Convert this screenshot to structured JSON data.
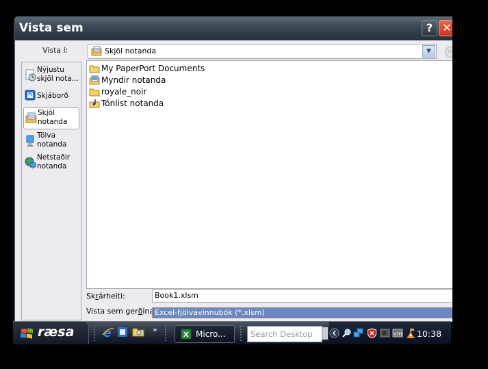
{
  "dialog": {
    "title": "Vista sem",
    "help_button": "?",
    "close_button": "✕",
    "look_in_label": "Vista í:",
    "look_in_value": "Skjöl notanda",
    "places": [
      {
        "label": "Nýjustu\nskjöl nota...",
        "icon": "recent-documents-icon",
        "selected": false
      },
      {
        "label": "Skjáborð",
        "icon": "desktop-icon",
        "selected": false
      },
      {
        "label": "Skjöl\nnotanda",
        "icon": "my-documents-icon",
        "selected": true
      },
      {
        "label": "Tölva\nnotanda",
        "icon": "my-computer-icon",
        "selected": false
      },
      {
        "label": "Netstaðir\nnotanda",
        "icon": "network-places-icon",
        "selected": false
      }
    ],
    "files": [
      {
        "name": "My PaperPort Documents",
        "icon": "folder-icon"
      },
      {
        "name": "Myndir notanda",
        "icon": "pictures-folder-icon"
      },
      {
        "name": "royale_noir",
        "icon": "folder-icon"
      },
      {
        "name": "Tónlist notanda",
        "icon": "music-folder-icon"
      }
    ],
    "file_name_label_pre": "Sk",
    "file_name_label_u": "r",
    "file_name_label_post": "árheiti:",
    "file_name_value": "Book1.xlsm",
    "file_type_label_pre": "Vista sem ger",
    "file_type_label_u": "ð",
    "file_type_label_post": "ina:",
    "file_type_value": "Excel-fjölvavinnubók (*.xlsm)"
  },
  "taskbar": {
    "start_label": "ræsa",
    "quick_launch_more": "»",
    "task_button_label": "Micro...",
    "search_placeholder": "Search Desktop",
    "clock": "10:38"
  }
}
